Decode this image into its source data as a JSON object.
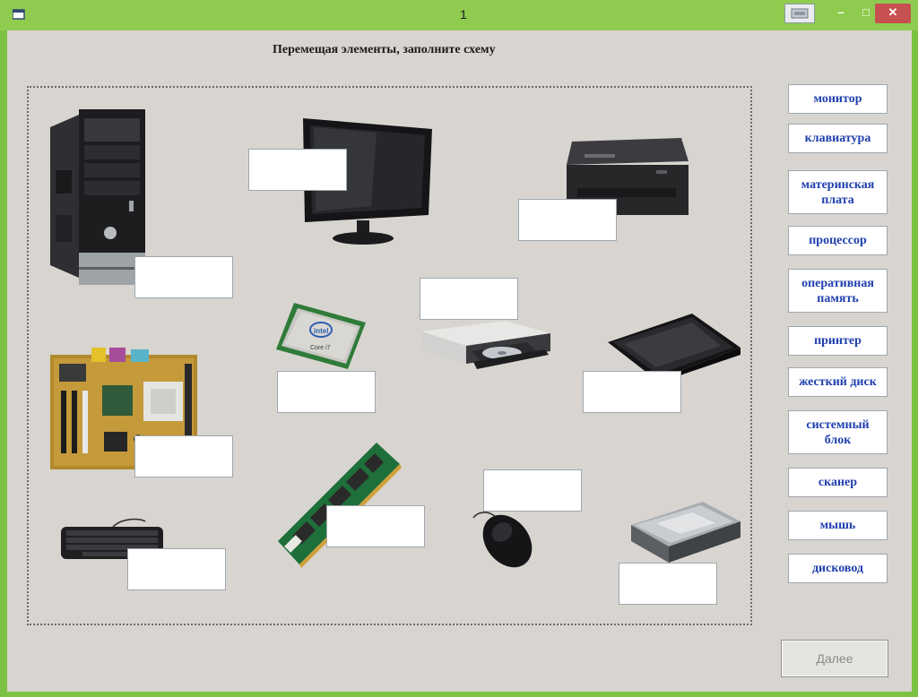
{
  "window": {
    "title": "1"
  },
  "heading": "Перемещая элементы, заполните схему",
  "drag_items": [
    "монитор",
    "клавиатура",
    "материнская плата",
    "процессор",
    "оперативная память",
    "принтер",
    "жесткий диск",
    "системный блок",
    "сканер",
    "мышь",
    "дисковод"
  ],
  "device_images": [
    "system-unit",
    "monitor",
    "printer",
    "motherboard",
    "processor",
    "optical-drive",
    "scanner",
    "ram-module",
    "keyboard",
    "mouse",
    "hard-disk"
  ],
  "next_button": "Далее",
  "colors": {
    "frame": "#7dc143",
    "client": "#d8d5d0",
    "label_text": "#1f3fae",
    "close": "#c75050"
  }
}
